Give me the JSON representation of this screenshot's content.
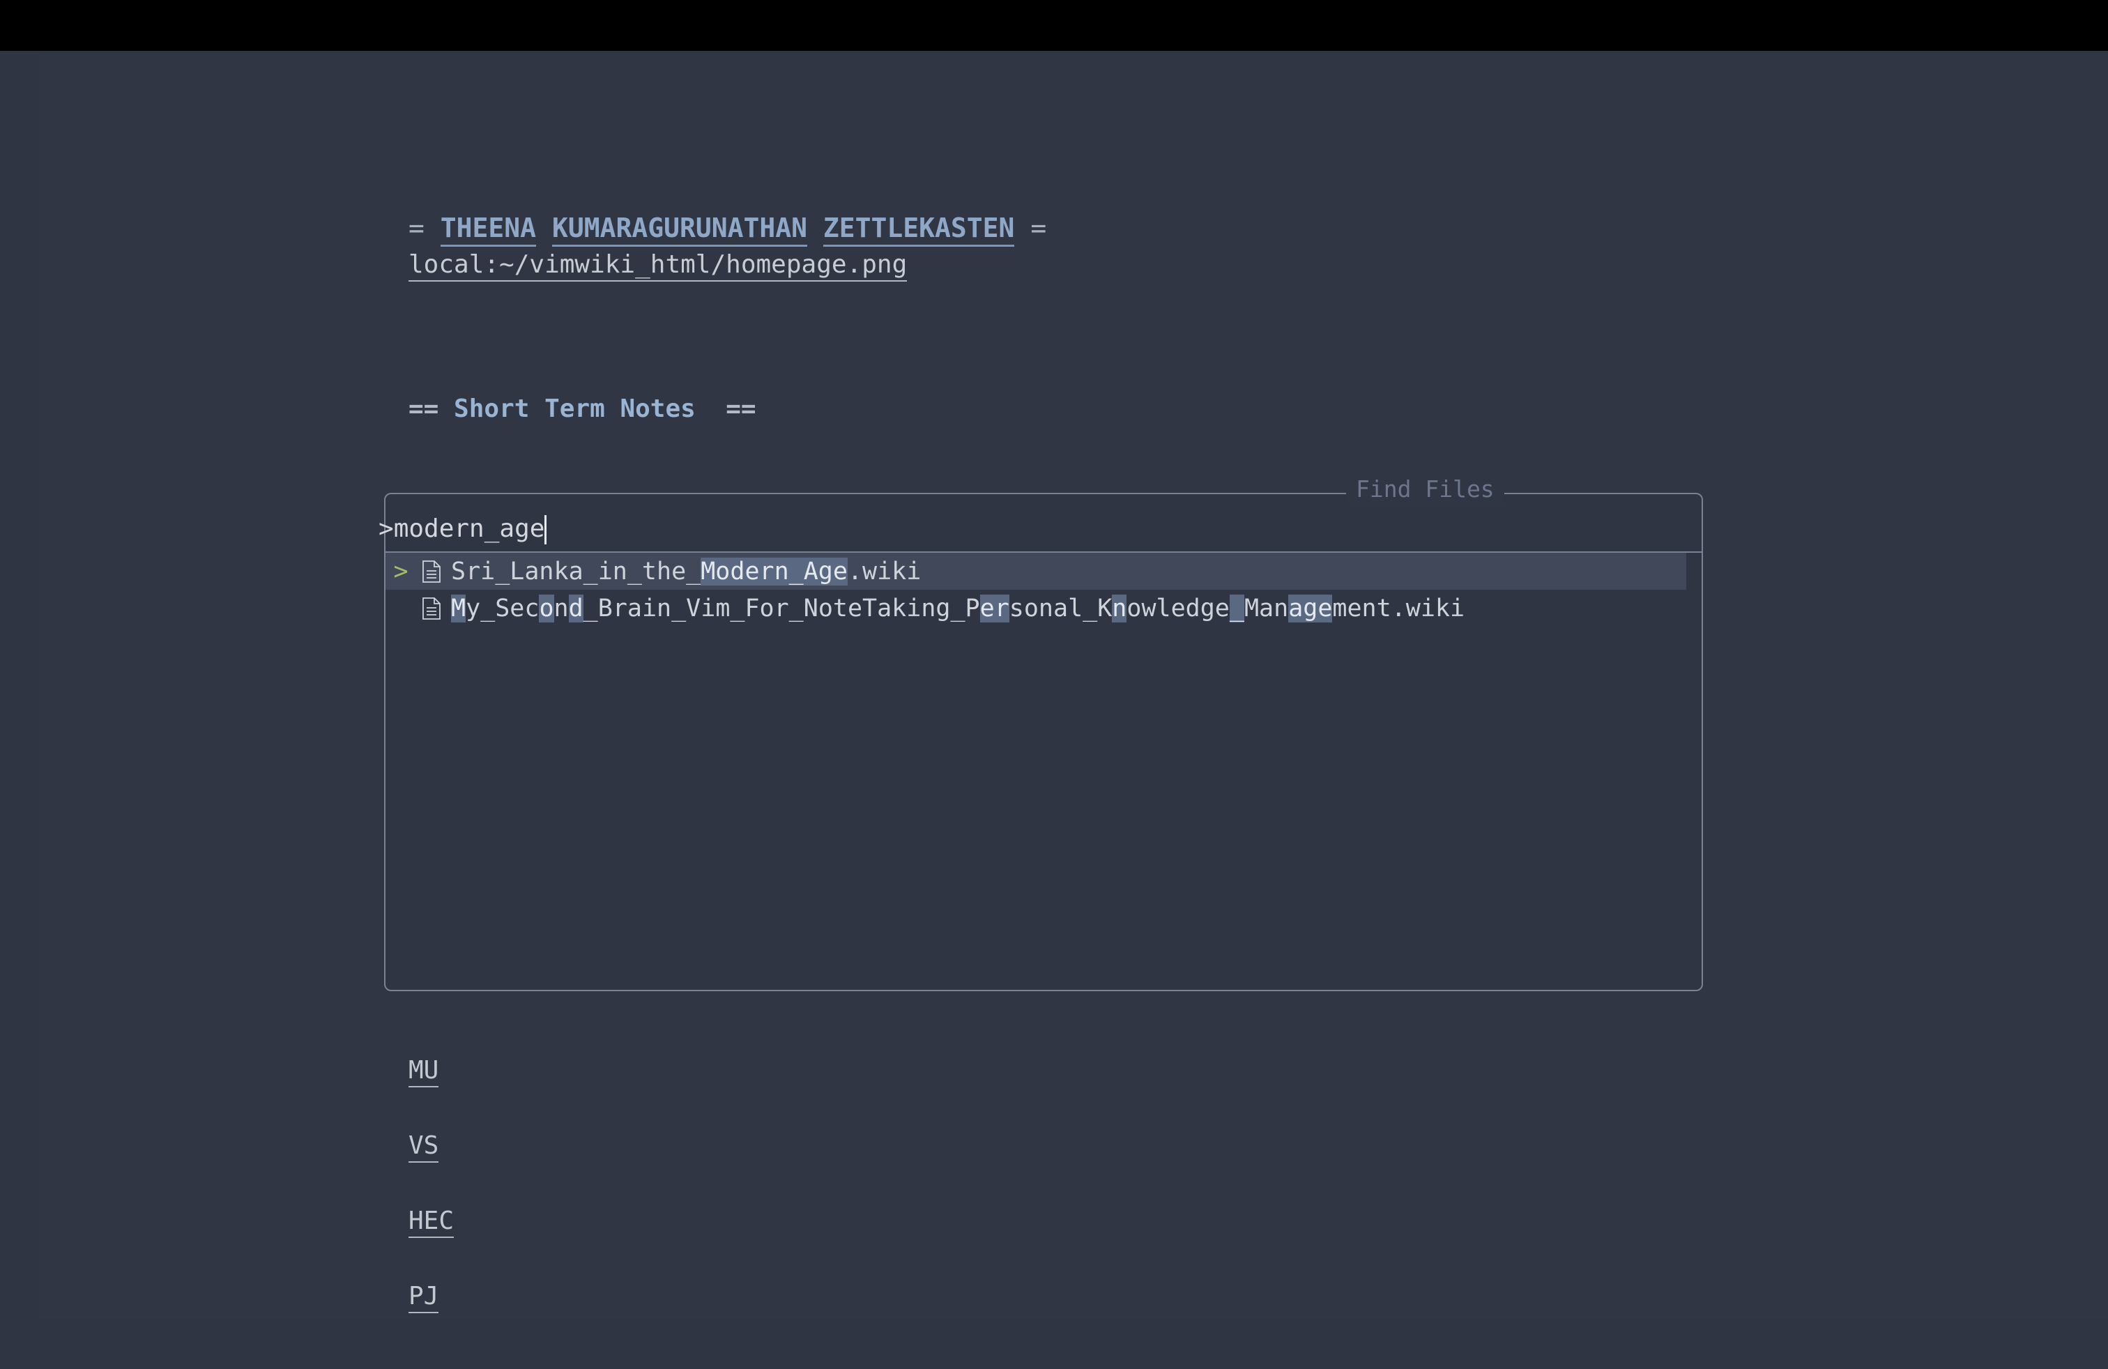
{
  "window": {
    "background_color": "#2f3542",
    "topbar_color": "#000000"
  },
  "wiki": {
    "title": {
      "marker_left": "=",
      "marker_right": "=",
      "words": [
        "THEENA",
        "KUMARAGURUNATHAN",
        "ZETTLEKASTEN"
      ],
      "color": "#8fa8c8"
    },
    "path": "local:~/vimwiki_html/homepage.png",
    "section_heading": {
      "marker_left": "==",
      "marker_right": "==",
      "text": "Short Term Notes",
      "color": "#9ab4d4"
    },
    "links": [
      {
        "label": "MU"
      },
      {
        "label": "VS"
      },
      {
        "label": "HEC"
      },
      {
        "label": "PJ"
      }
    ]
  },
  "finder": {
    "title": "Find Files",
    "prompt_symbol": ">",
    "query": "modern_age",
    "placeholder": "",
    "selection_caret": "> ",
    "results": [
      {
        "icon": "file-icon",
        "selected": true,
        "segments": [
          {
            "text": "Sri_Lanka_in_the_",
            "match": false
          },
          {
            "text": "Modern_Age",
            "match": true
          },
          {
            "text": ".wiki",
            "match": false
          }
        ],
        "full_text": "Sri_Lanka_in_the_Modern_Age.wiki"
      },
      {
        "icon": "file-icon",
        "selected": false,
        "segments": [
          {
            "text": "M",
            "match": true
          },
          {
            "text": "y_Sec",
            "match": false
          },
          {
            "text": "o",
            "match": true
          },
          {
            "text": "n",
            "match": false
          },
          {
            "text": "d",
            "match": true
          },
          {
            "text": "_Brain_Vim_For_NoteTaking_P",
            "match": false
          },
          {
            "text": "er",
            "match": true
          },
          {
            "text": "sonal_K",
            "match": false
          },
          {
            "text": "n",
            "match": true
          },
          {
            "text": "owledge",
            "match": false
          },
          {
            "text": "_",
            "match": true
          },
          {
            "text": "Man",
            "match": false
          },
          {
            "text": "age",
            "match": true
          },
          {
            "text": "ment.wiki",
            "match": false
          }
        ],
        "full_text": "My_Second_Brain_Vim_For_NoteTaking_Personal_Knowledge_Management.wiki"
      }
    ],
    "colors": {
      "border": "#7b8296",
      "title": "#6d768c",
      "selected_row_bg": "#414859",
      "match_highlight_bg": "#5a6882",
      "caret": "#a4bd6a"
    }
  }
}
